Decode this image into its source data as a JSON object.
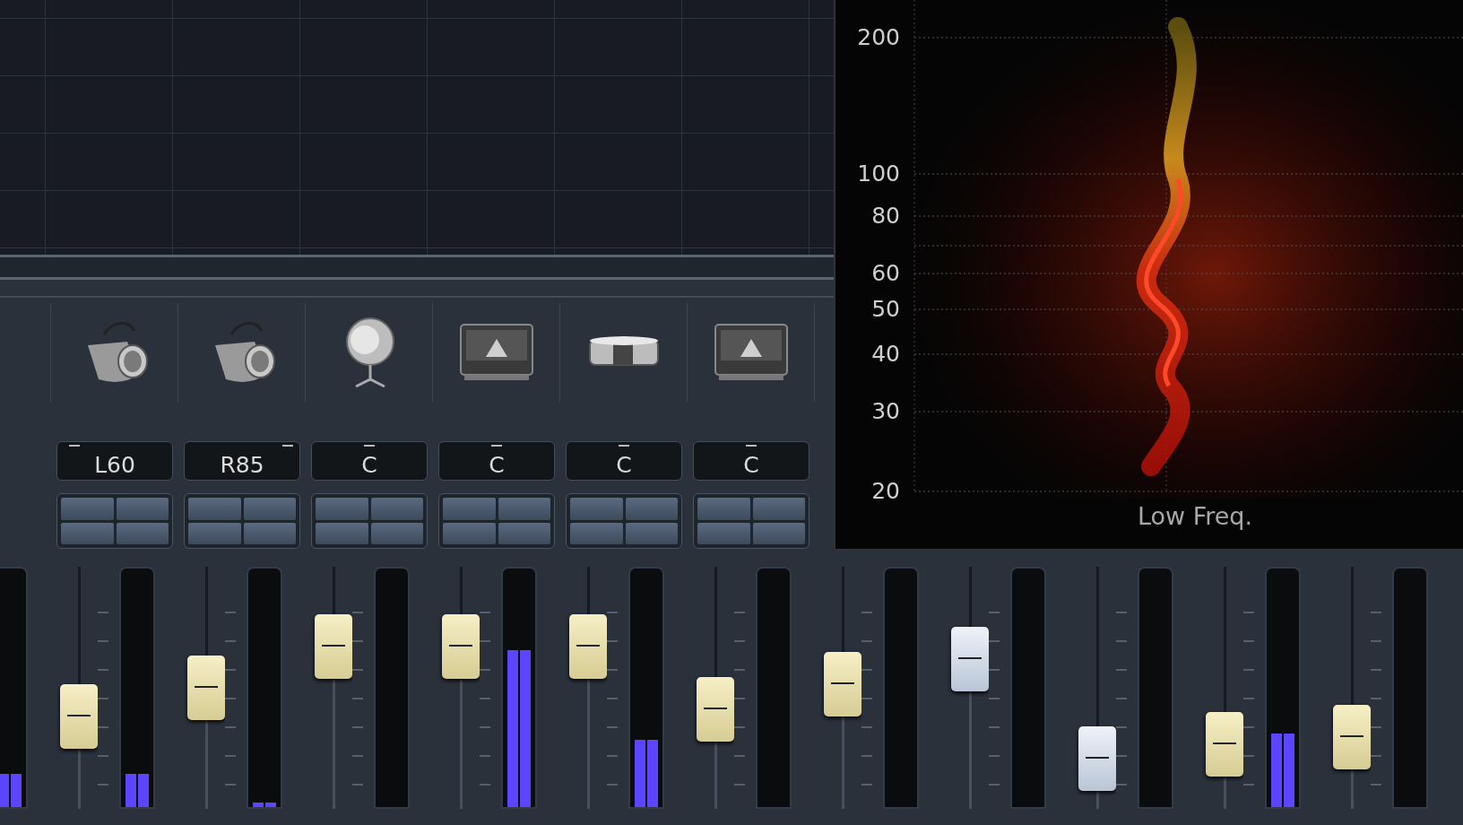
{
  "strips": [
    {
      "meter": {
        "level": 0.15
      }
    },
    {
      "kind": "bell",
      "pan": {
        "label": "L60",
        "level": 0.15
      },
      "fader": {
        "level": 0.34,
        "selected": false
      },
      "meter": {
        "level": 0.15
      }
    },
    {
      "kind": "bell",
      "pan": {
        "label": "R85",
        "level": 0.9
      },
      "fader": {
        "level": 0.5,
        "selected": false
      },
      "meter": {
        "level": 0.02
      }
    },
    {
      "kind": "mic",
      "pan": {
        "label": "C",
        "level": 0.5
      },
      "fader": {
        "level": 0.73,
        "selected": false
      },
      "meter": {
        "level": 0
      }
    },
    {
      "kind": "amp",
      "pan": {
        "label": "C",
        "level": 0.5
      },
      "fader": {
        "level": 0.73,
        "selected": false
      },
      "meter": {
        "level": 0.7
      }
    },
    {
      "kind": "drum",
      "pan": {
        "label": "C",
        "level": 0.5
      },
      "fader": {
        "level": 0.73,
        "selected": false
      },
      "meter": {
        "level": 0.3
      }
    },
    {
      "kind": "amp",
      "pan": {
        "label": "C",
        "level": 0.5
      },
      "fader": {
        "level": 0.38,
        "selected": false
      },
      "meter": {
        "level": 0
      }
    },
    {
      "fader": {
        "level": 0.52,
        "selected": false
      },
      "meter": {
        "level": 0
      }
    },
    {
      "fader": {
        "level": 0.66,
        "selected": true
      },
      "meter": {
        "level": 0
      }
    },
    {
      "fader": {
        "level": 0.1,
        "selected": true
      },
      "meter": {
        "level": 0
      }
    },
    {
      "fader": {
        "level": 0.18,
        "selected": false
      },
      "meter": {
        "level": 0.33
      }
    },
    {
      "fader": {
        "level": 0.22,
        "selected": false
      },
      "meter": {
        "level": 0
      }
    }
  ],
  "spectrum": {
    "axis_labels": [
      "200",
      "100",
      "80",
      "60",
      "50",
      "40",
      "30",
      "20"
    ],
    "caption": "Low Freq."
  }
}
